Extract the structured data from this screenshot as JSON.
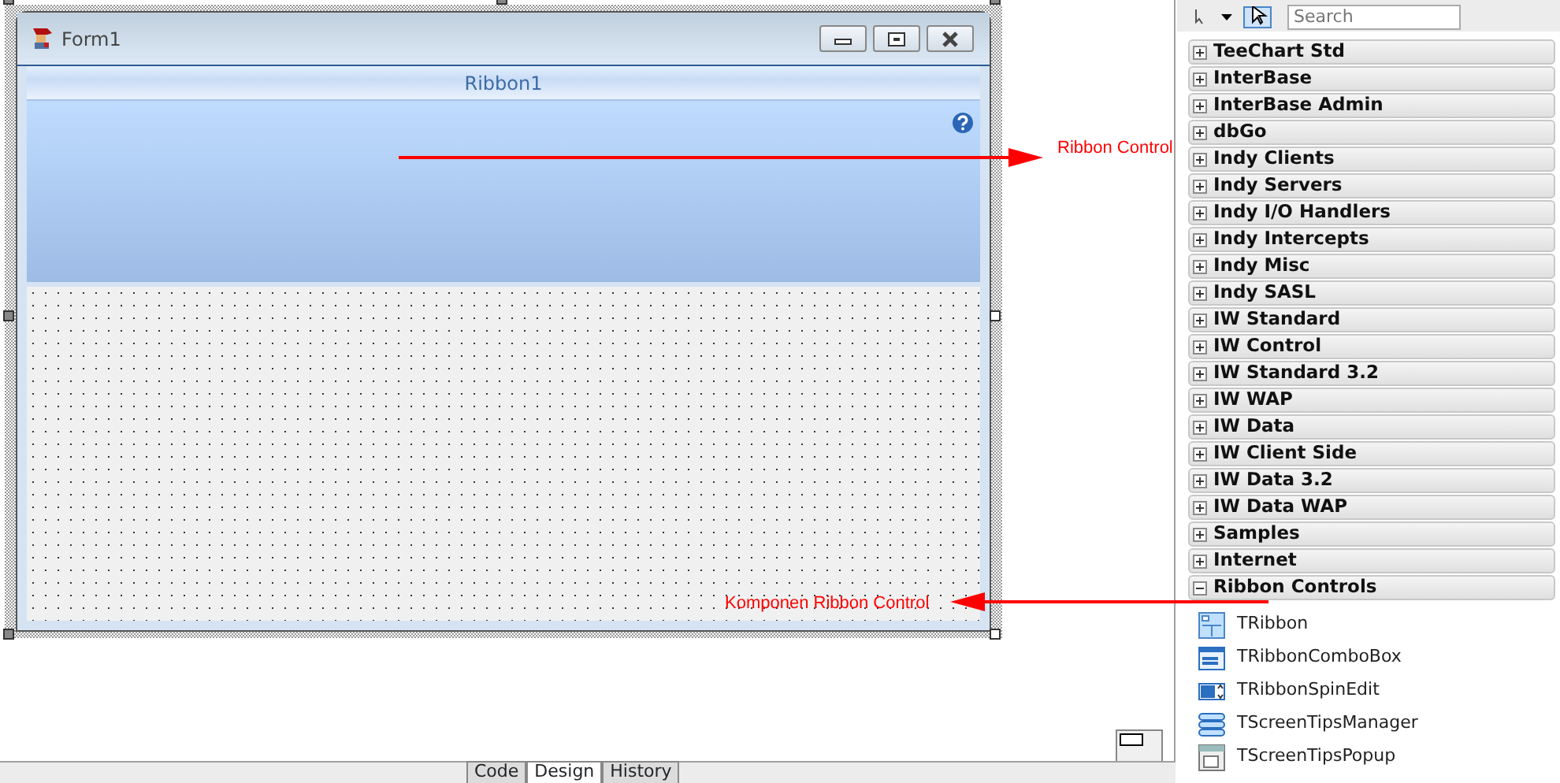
{
  "form": {
    "title": "Form1",
    "ribbon_caption": "Ribbon1"
  },
  "annotations": [
    {
      "text": "Ribbon Control"
    },
    {
      "text": "Komponen Ribbon Control"
    }
  ],
  "editor_tabs": [
    {
      "label": "Code",
      "selected": false
    },
    {
      "label": "Design",
      "selected": true
    },
    {
      "label": "History",
      "selected": false
    }
  ],
  "palette": {
    "search": {
      "placeholder": "Search"
    },
    "categories": [
      {
        "label": "TeeChart Std",
        "expanded": false
      },
      {
        "label": "InterBase",
        "expanded": false
      },
      {
        "label": "InterBase Admin",
        "expanded": false
      },
      {
        "label": "dbGo",
        "expanded": false
      },
      {
        "label": "Indy Clients",
        "expanded": false
      },
      {
        "label": "Indy Servers",
        "expanded": false
      },
      {
        "label": "Indy I/O Handlers",
        "expanded": false
      },
      {
        "label": "Indy Intercepts",
        "expanded": false
      },
      {
        "label": "Indy Misc",
        "expanded": false
      },
      {
        "label": "Indy SASL",
        "expanded": false
      },
      {
        "label": "IW Standard",
        "expanded": false
      },
      {
        "label": "IW Control",
        "expanded": false
      },
      {
        "label": "IW Standard 3.2",
        "expanded": false
      },
      {
        "label": "IW WAP",
        "expanded": false
      },
      {
        "label": "IW Data",
        "expanded": false
      },
      {
        "label": "IW Client Side",
        "expanded": false
      },
      {
        "label": "IW Data 3.2",
        "expanded": false
      },
      {
        "label": "IW Data WAP",
        "expanded": false
      },
      {
        "label": "Samples",
        "expanded": false
      },
      {
        "label": "Internet",
        "expanded": false
      },
      {
        "label": "Ribbon Controls",
        "expanded": true,
        "items": [
          {
            "label": "TRibbon"
          },
          {
            "label": "TRibbonComboBox"
          },
          {
            "label": "TRibbonSpinEdit"
          },
          {
            "label": "TScreenTipsManager"
          },
          {
            "label": "TScreenTipsPopup"
          }
        ]
      }
    ]
  }
}
